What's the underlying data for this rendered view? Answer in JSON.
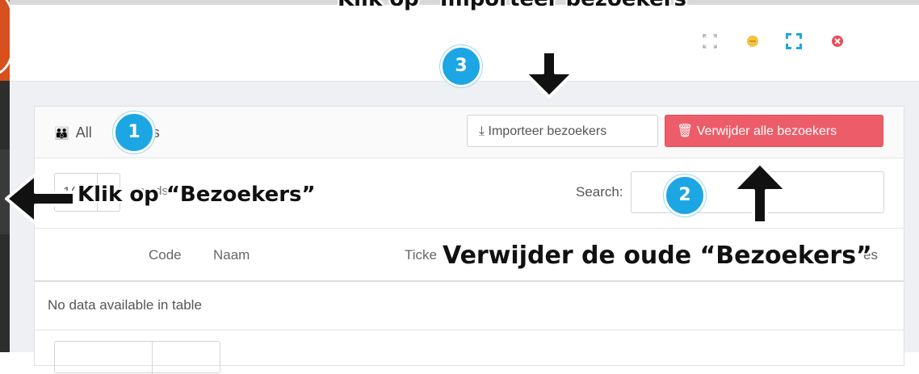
{
  "window": {
    "controls": [
      "compress-icon",
      "minimize-icon",
      "expand-icon",
      "close-icon"
    ]
  },
  "panel": {
    "title_visible": "All",
    "title_tail": "ekers",
    "import_button": "⤓ Importeer bezoekers",
    "delete_button": "🗑 Verwijder alle bezoekers"
  },
  "table_controls": {
    "length_value": "1(",
    "length_text_fragment": "ecords",
    "search_label": "Search:"
  },
  "table": {
    "columns": {
      "code": "Code",
      "naam": "Naam",
      "ticket_fragment": "Ticke",
      "extra_fragment": "es"
    },
    "empty_message": "No data available in table"
  },
  "annotations": {
    "import_instruction": "Klik op “Importeer bezoekers”",
    "bezoekers_instruction": "Klik op “Bezoekers”",
    "delete_instruction": "Verwijder de oude “Bezoekers”",
    "step_1": "1",
    "step_2": "2",
    "step_3": "3"
  },
  "colors": {
    "delete_button": "#ec5d69",
    "badge": "#1da6e4",
    "sidebar_accent": "#d8501e",
    "minimize_dot": "#f5c342",
    "close_dot": "#ea4c5a",
    "expand_corners": "#1da6e4"
  }
}
